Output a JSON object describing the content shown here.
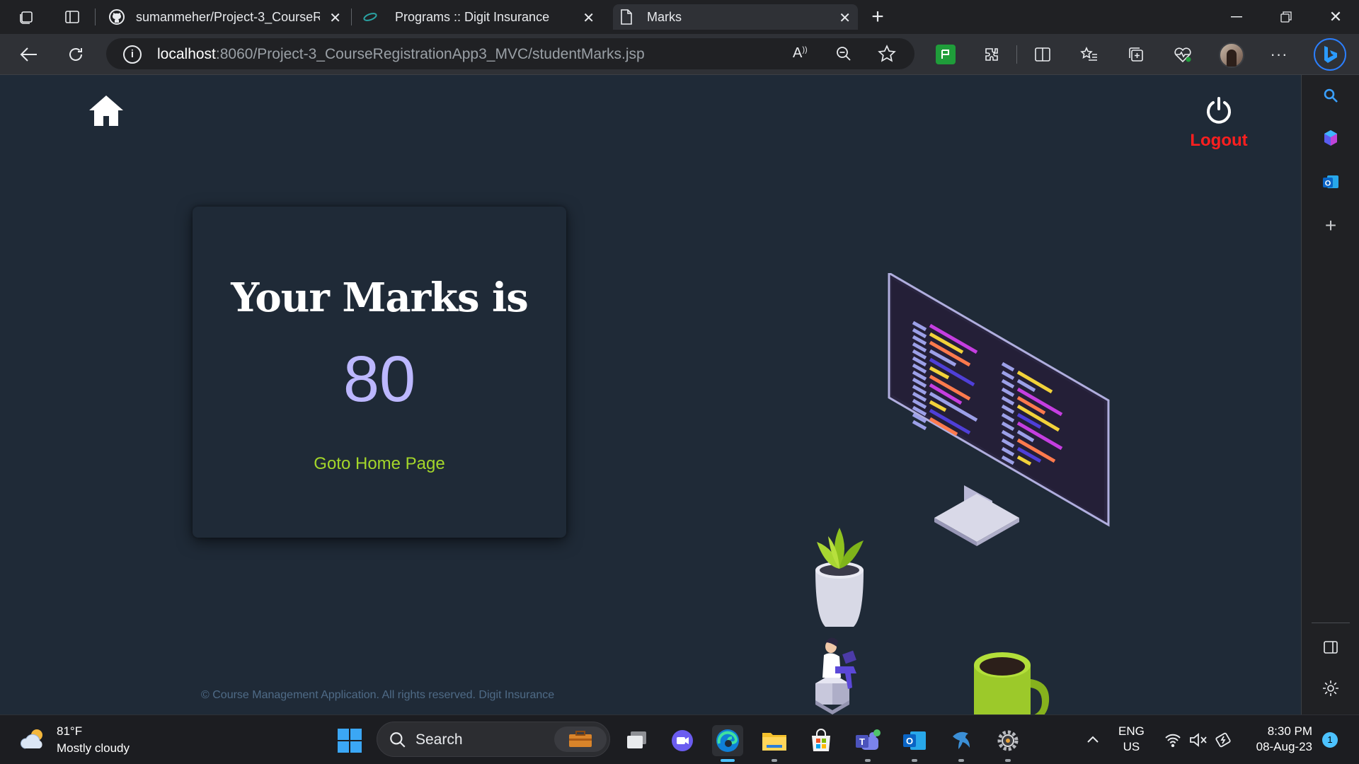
{
  "browser": {
    "tabs": [
      {
        "title": "sumanmeher/Project-3_CourseR",
        "icon": "github-icon"
      },
      {
        "title": "Programs :: Digit Insurance",
        "icon": "digit-logo-icon"
      },
      {
        "title": "Marks",
        "icon": "page-icon",
        "active": true
      }
    ],
    "url_host": "localhost",
    "url_path": ":8060/Project-3_CourseRegistrationApp3_MVC/studentMarks.jsp"
  },
  "page": {
    "logout_label": "Logout",
    "card": {
      "title": "Your Marks is",
      "marks": "80",
      "link_label": "Goto Home Page"
    },
    "footer": "© Course Management Application. All rights reserved. Digit Insurance",
    "colors": {
      "background": "#1f2a37",
      "marks": "#bcb7ff",
      "link": "#a4d62a",
      "logout": "#ff1f1f"
    }
  },
  "taskbar": {
    "weather_temp": "81°F",
    "weather_desc": "Mostly cloudy",
    "search_label": "Search",
    "lang_line1": "ENG",
    "lang_line2": "US",
    "time": "8:30 PM",
    "date": "08-Aug-23",
    "notification_count": "1"
  }
}
